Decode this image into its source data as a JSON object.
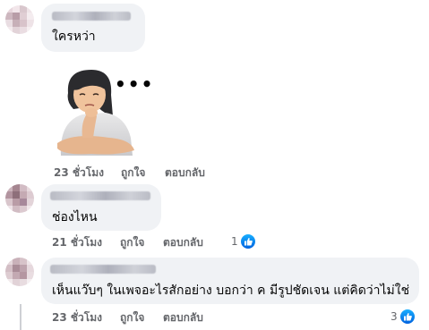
{
  "comments": [
    {
      "text": "ใครหว่า",
      "time": "23 ชั่วโมง",
      "like_label": "ถูกใจ",
      "reply_label": "ตอบกลับ"
    },
    {
      "sticker": "sticker-woman-thinking",
      "time": "23 ชั่วโมง",
      "like_label": "ถูกใจ",
      "reply_label": "ตอบกลับ",
      "more_label": "•••"
    },
    {
      "text": "ช่องไหน",
      "time": "21 ชั่วโมง",
      "like_label": "ถูกใจ",
      "reply_label": "ตอบกลับ",
      "reaction_count": "1"
    },
    {
      "text": "เห็นแว๊บๆ ในเพจอะไรสักอย่าง บอกว่า ค มีรูปชัดเจน แต่คิดว่าไม่ใช่",
      "time": "23 ชั่วโมง",
      "like_label": "ถูกใจ",
      "reply_label": "ตอบกลับ",
      "reaction_count": "3"
    }
  ],
  "colors": {
    "bubble": "#f0f2f5",
    "meta_text": "#65676b",
    "like_blue": "#1877f2"
  },
  "icons": [
    "like-icon",
    "more-dots-icon"
  ]
}
